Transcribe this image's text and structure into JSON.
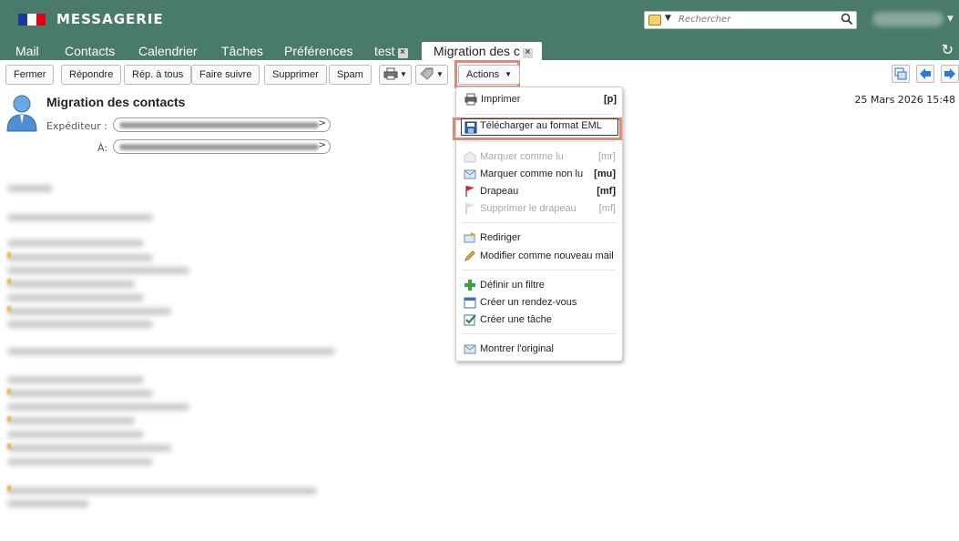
{
  "app": {
    "title": "MESSAGERIE",
    "flag_colors": [
      "#1a3a9a",
      "#ffffff",
      "#e1000f"
    ]
  },
  "search": {
    "placeholder": "Rechercher"
  },
  "tabs": [
    {
      "label": "Mail"
    },
    {
      "label": "Contacts"
    },
    {
      "label": "Calendrier"
    },
    {
      "label": "Tâches"
    },
    {
      "label": "Préférences"
    },
    {
      "label": "test",
      "closable": true
    },
    {
      "label": "Migration des c",
      "closable": true,
      "active": true
    }
  ],
  "toolbar": {
    "close": "Fermer",
    "reply": "Répondre",
    "reply_all": "Rép. à tous",
    "forward": "Faire suivre",
    "delete": "Supprimer",
    "spam": "Spam",
    "print_icon": "printer-icon",
    "tag_icon": "tag-icon",
    "actions": "Actions"
  },
  "message": {
    "subject": "Migration des contacts",
    "date": "25 Mars 2026 15:48",
    "from_label": "Expéditeur :",
    "to_label": "À:"
  },
  "actions_menu": {
    "items": [
      {
        "label": "Imprimer",
        "shortcut": "[p]",
        "icon": "printer-icon",
        "enabled": true
      },
      {
        "label": "Télécharger au format EML",
        "shortcut": "",
        "icon": "floppy-icon",
        "enabled": true,
        "highlighted": true
      },
      {
        "label": "Marquer comme lu",
        "shortcut": "[mr]",
        "icon": "envelope-open-icon",
        "enabled": false
      },
      {
        "label": "Marquer comme non lu",
        "shortcut": "[mu]",
        "icon": "envelope-icon",
        "enabled": true
      },
      {
        "label": "Drapeau",
        "shortcut": "[mf]",
        "icon": "flag-red-icon",
        "enabled": true
      },
      {
        "label": "Supprimer le drapeau",
        "shortcut": "[mf]",
        "icon": "flag-grey-icon",
        "enabled": false
      },
      {
        "label": "Rediriger",
        "shortcut": "",
        "icon": "redirect-icon",
        "enabled": true
      },
      {
        "label": "Modifier comme nouveau mail",
        "shortcut": "",
        "icon": "pencil-icon",
        "enabled": true
      },
      {
        "label": "Définir un filtre",
        "shortcut": "",
        "icon": "plus-green-icon",
        "enabled": true
      },
      {
        "label": "Créer un rendez-vous",
        "shortcut": "",
        "icon": "calendar-icon",
        "enabled": true
      },
      {
        "label": "Créer une tâche",
        "shortcut": "",
        "icon": "task-check-icon",
        "enabled": true
      },
      {
        "label": "Montrer l'original",
        "shortcut": "",
        "icon": "envelope-icon",
        "enabled": true
      }
    ]
  },
  "colors": {
    "header": "#4a7a6a",
    "highlight": "#df8a76"
  }
}
